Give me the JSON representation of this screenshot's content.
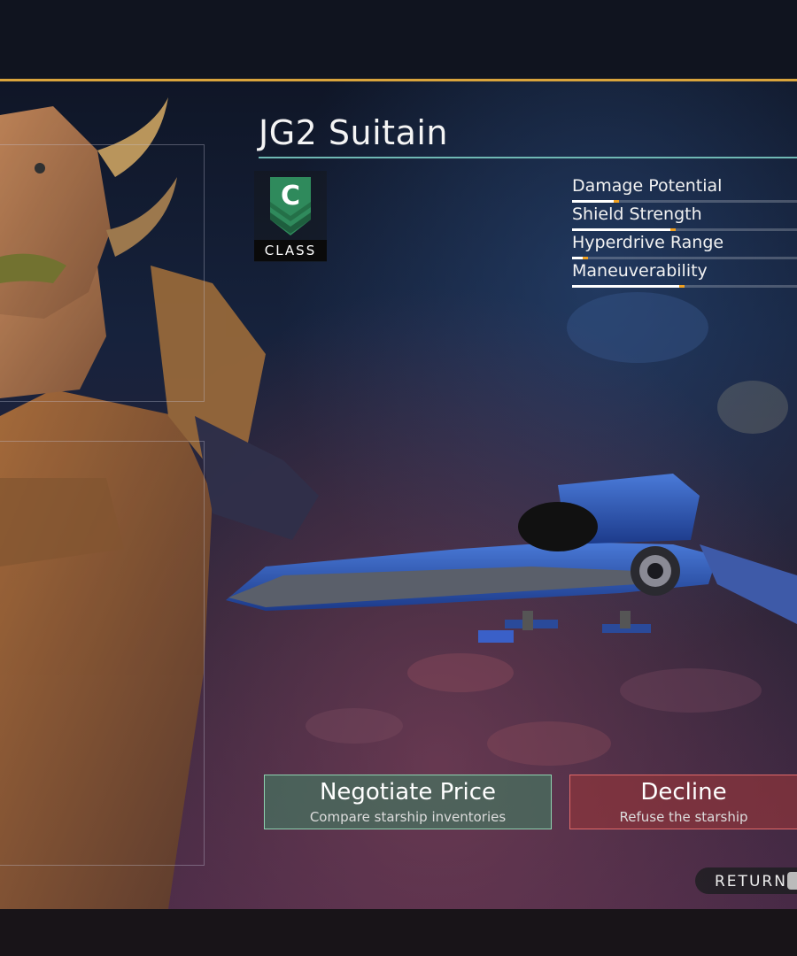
{
  "ship": {
    "name": "JG2 Suitain",
    "class_letter": "C",
    "class_label": "CLASS"
  },
  "stats": [
    {
      "name": "Damage Potential",
      "level": 0.21
    },
    {
      "name": "Shield Strength",
      "level": 0.46
    },
    {
      "name": "Hyperdrive Range",
      "level": 0.07
    },
    {
      "name": "Maneuverability",
      "level": 0.5
    }
  ],
  "actions": {
    "negotiate": {
      "title": "Negotiate Price",
      "subtitle": "Compare starship inventories"
    },
    "decline": {
      "title": "Decline",
      "subtitle": "Refuse the starship"
    }
  },
  "return_label": "RETURN",
  "colors": {
    "accent_gold": "#d9a43c",
    "title_rule": "#6fb8b4",
    "class_badge": "#2f8a5c",
    "negotiate": "#46735f",
    "decline": "#8c343c",
    "stat_tip": "#f0a020"
  },
  "icons": {
    "class": "class-chevron-icon",
    "return_key": "keyboard-key-icon"
  }
}
